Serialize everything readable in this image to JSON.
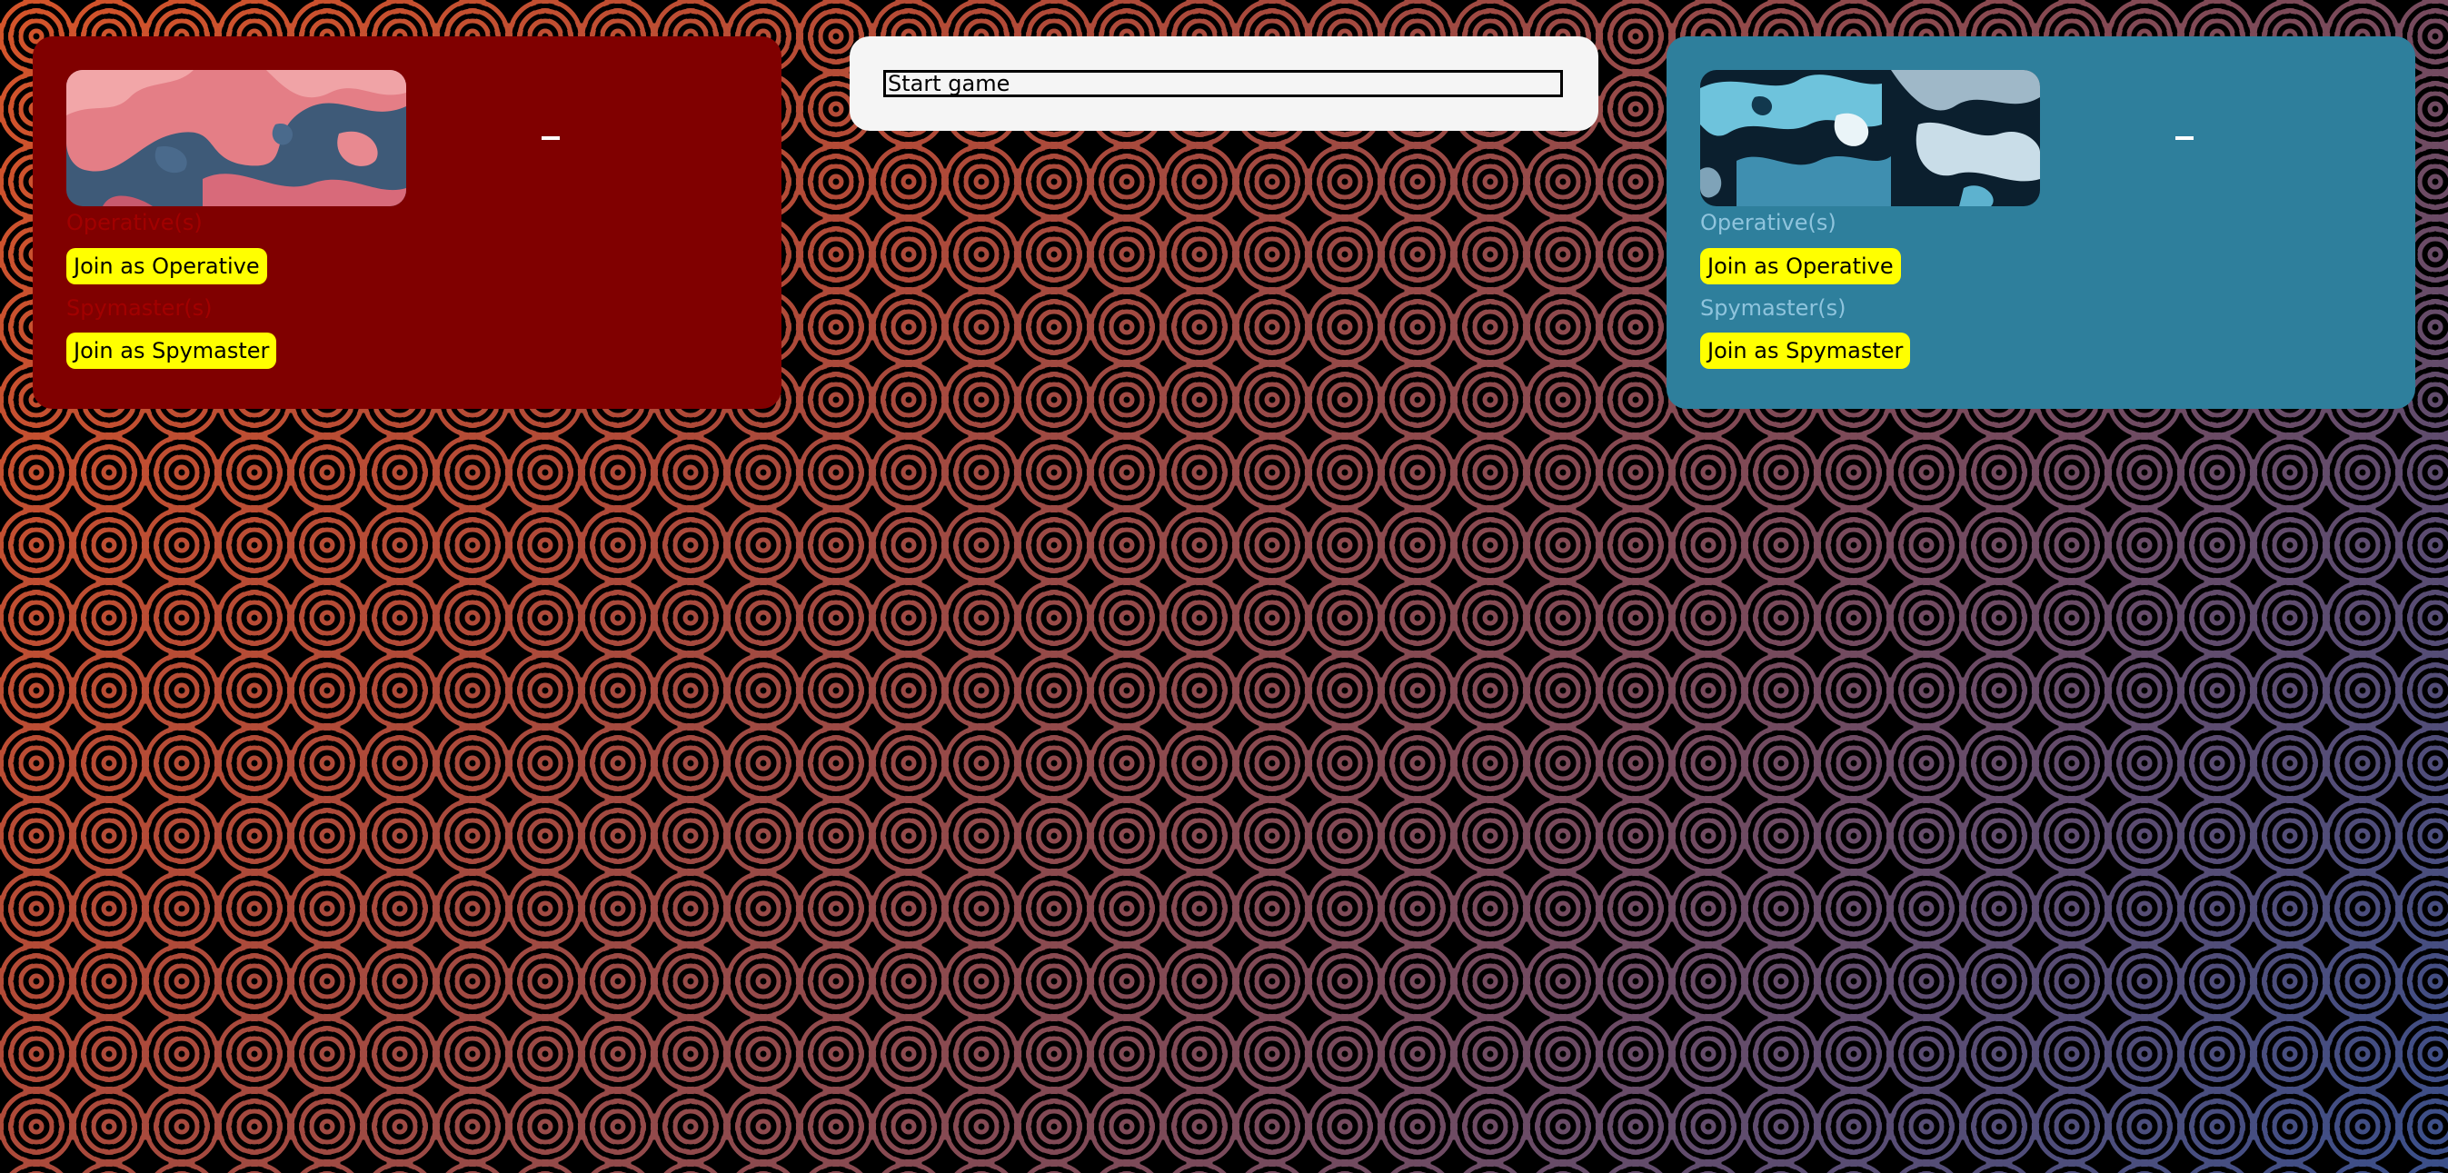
{
  "red_team": {
    "score": "-",
    "operatives_label": "Operative(s)",
    "join_operative_label": "Join as Operative",
    "spymasters_label": "Spymaster(s)",
    "join_spymaster_label": "Join as Spymaster",
    "color": "#800000"
  },
  "blue_team": {
    "score": "-",
    "operatives_label": "Operative(s)",
    "join_operative_label": "Join as Operative",
    "spymasters_label": "Spymaster(s)",
    "join_spymaster_label": "Join as Spymaster",
    "color": "#2e7f9c"
  },
  "lobby": {
    "start_label": "Start game"
  },
  "accent": {
    "button_bg": "#ffff00"
  }
}
